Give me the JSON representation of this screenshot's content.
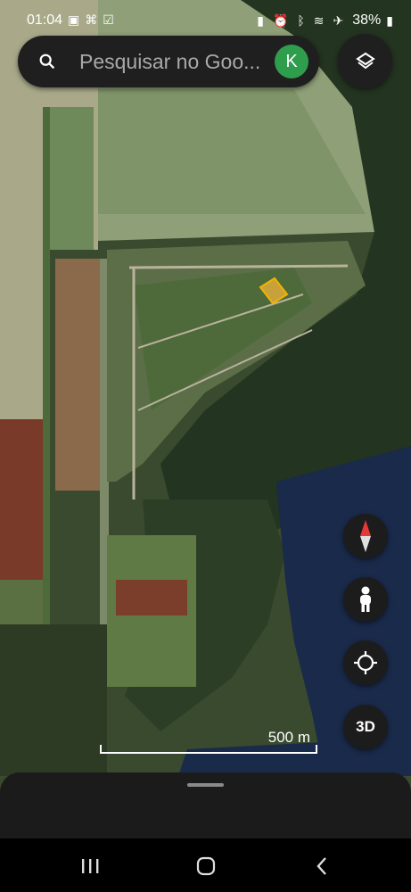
{
  "status_bar": {
    "time": "01:04",
    "battery": "38%",
    "left_icons": [
      "image-icon",
      "link-icon",
      "check-icon"
    ],
    "right_icons": [
      "battery-saver-icon",
      "alarm-icon",
      "bluetooth-icon",
      "wifi-icon",
      "airplane-icon",
      "battery-icon"
    ]
  },
  "search": {
    "placeholder": "Pesquisar no Goo...",
    "account_initial": "K",
    "account_color": "#2e9e4c"
  },
  "controls": {
    "layers_icon": "layers-icon",
    "compass_icon": "compass-icon",
    "pegman_icon": "street-view-icon",
    "locate_icon": "my-location-icon",
    "three_d_label": "3D"
  },
  "map": {
    "scale_label": "500 m",
    "view": "satellite"
  },
  "nav": {
    "recents_icon": "recents-icon",
    "home_icon": "home-icon",
    "back_icon": "back-icon"
  }
}
